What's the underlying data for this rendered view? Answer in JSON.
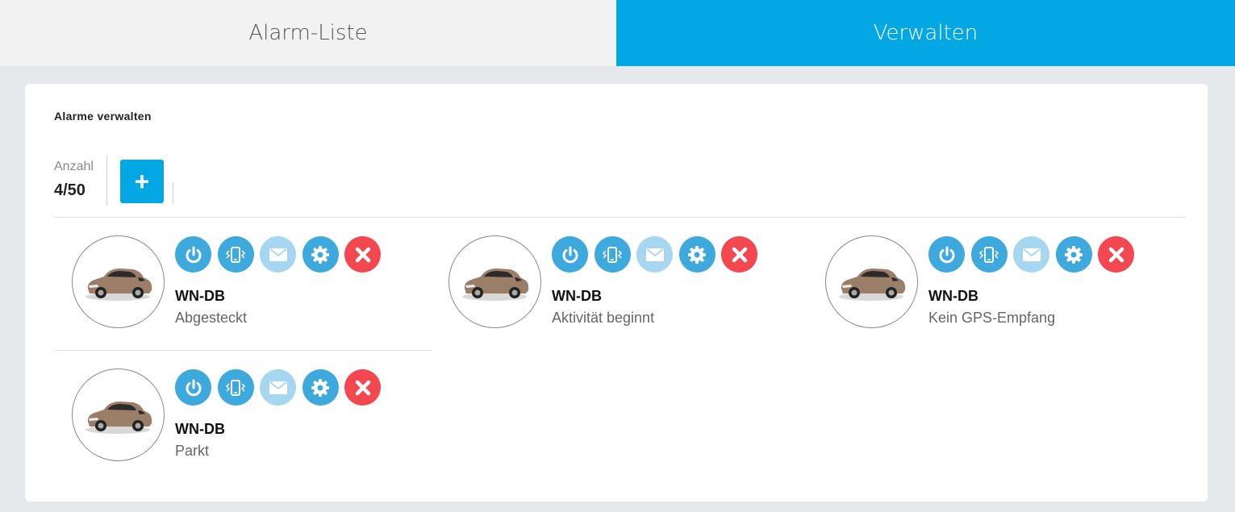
{
  "tabs": [
    {
      "label": "Alarm-Liste",
      "active": false
    },
    {
      "label": "Verwalten",
      "active": true
    }
  ],
  "colors": {
    "accent": "#03a7e3",
    "action_blue": "#3ea9dd",
    "action_light": "#a7d7f0",
    "delete_red": "#f3484f"
  },
  "panel": {
    "title": "Alarme verwalten",
    "count_label": "Anzahl",
    "count_value": "4/50",
    "add_label": "+"
  },
  "icons": [
    "power-icon",
    "vibrate-phone-icon",
    "mail-icon",
    "gear-icon",
    "close-icon"
  ],
  "alarms": [
    {
      "plate": "WN-DB",
      "status": "Abgesteckt"
    },
    {
      "plate": "WN-DB",
      "status": "Aktivität beginnt"
    },
    {
      "plate": "WN-DB",
      "status": "Kein GPS-Empfang"
    },
    {
      "plate": "WN-DB",
      "status": "Parkt"
    }
  ]
}
